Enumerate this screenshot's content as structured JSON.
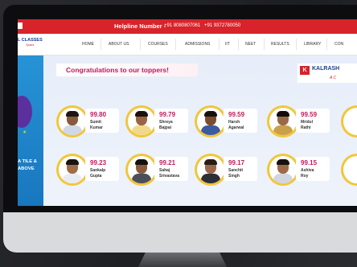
{
  "topbar": {
    "helpline_label": "Helpline Number -",
    "phone1": "+91 8080807061",
    "phone2": "+91 9372780050"
  },
  "logo": {
    "line1": "L CLASSES",
    "line2": "Spark"
  },
  "nav": {
    "items": [
      "HOME",
      "ABOUT US",
      "COURSES",
      "ADMISSIONS",
      "IIT",
      "NEET",
      "RESULTS",
      "LIBRARY",
      "CON"
    ]
  },
  "left_panel": {
    "line1": "A TILE &",
    "line2": "ABOVE"
  },
  "banner": {
    "title": "Congratulations to our toppers!"
  },
  "brand": {
    "badge": "K",
    "name": "KALRASH",
    "sub": "A C"
  },
  "toppers": [
    {
      "score": "99.80",
      "first": "Sumit",
      "last": "Kumar",
      "shirt": "#cfd8e6",
      "hair": "#1d1511",
      "skin": "#8a5a3a"
    },
    {
      "score": "99.79",
      "first": "Shreya",
      "last": "Bajpai",
      "shirt": "#f0d98a",
      "hair": "#1a1210",
      "skin": "#9a6444"
    },
    {
      "score": "99.59",
      "first": "Harsh",
      "last": "Agarwal",
      "shirt": "#3b5aa0",
      "hair": "#16100d",
      "skin": "#7a4c30"
    },
    {
      "score": "99.59",
      "first": "Mridul",
      "last": "Rathi",
      "shirt": "#c9a04a",
      "hair": "#120c0a",
      "skin": "#9a6a48"
    },
    {
      "score": "99.23",
      "first": "Sankalp",
      "last": "Gupta",
      "shirt": "#e8ecf2",
      "hair": "#1b1310",
      "skin": "#a06c48"
    },
    {
      "score": "99.21",
      "first": "Sahaj",
      "last": "Srivastava",
      "shirt": "#4a4f5a",
      "hair": "#17110e",
      "skin": "#8a5a3a"
    },
    {
      "score": "99.17",
      "first": "Sanchit",
      "last": "Singh",
      "shirt": "#2c2f36",
      "hair": "#2a1c14",
      "skin": "#9a6848"
    },
    {
      "score": "99.15",
      "first": "Ashiva",
      "last": "Roy",
      "shirt": "#cfd6e0",
      "hair": "#18110d",
      "skin": "#9c6a46"
    }
  ]
}
